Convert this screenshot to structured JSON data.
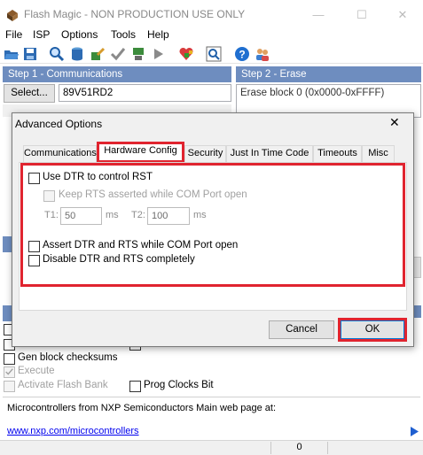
{
  "window": {
    "title": "Flash Magic - NON PRODUCTION USE ONLY",
    "minimize": "—",
    "maximize": "☐",
    "close": "✕"
  },
  "menu": [
    "File",
    "ISP",
    "Options",
    "Tools",
    "Help"
  ],
  "toolbar": [
    "open-icon",
    "save-icon",
    "search-icon",
    "database-icon",
    "program-icon",
    "verify-check-icon",
    "download-icon",
    "arrow-right-icon",
    "heart-gem-icon",
    "chip-icon",
    "help-icon",
    "users-icon"
  ],
  "step1": {
    "header": "Step 1 - Communications",
    "select_label": "Select...",
    "device": "89V51RD2"
  },
  "step2": {
    "header": "Step 2 - Erase",
    "erase_item": "Erase block 0 (0x0000-0xFFFF)"
  },
  "options": {
    "gen_block_checksums": "Gen block checksums",
    "execute": "Execute",
    "activate_flash_bank": "Activate Flash Bank",
    "prog_clocks_bit": "Prog Clocks Bit"
  },
  "footer": {
    "info": "Microcontrollers from NXP Semiconductors Main web page at:",
    "link": "www.nxp.com/microcontrollers",
    "status_value": "0"
  },
  "dialog": {
    "title": "Advanced Options",
    "close": "✕",
    "tabs": [
      "Communications",
      "Hardware Config",
      "Security",
      "Just In Time Code",
      "Timeouts",
      "Misc"
    ],
    "active_tab": "Hardware Config",
    "use_dtr": "Use DTR to control RST",
    "keep_rts": "Keep RTS asserted while COM Port open",
    "t1_label": "T1:",
    "t1_value": "50",
    "t1_unit": "ms",
    "t2_label": "T2:",
    "t2_value": "100",
    "t2_unit": "ms",
    "assert_dtr_rts": "Assert DTR and RTS while COM Port open",
    "disable_dtr_rts": "Disable DTR and RTS completely",
    "cancel": "Cancel",
    "ok": "OK"
  },
  "colors": {
    "section_header": "#6e8dbf",
    "highlight": "#e0242f",
    "link": "#0000ee"
  }
}
